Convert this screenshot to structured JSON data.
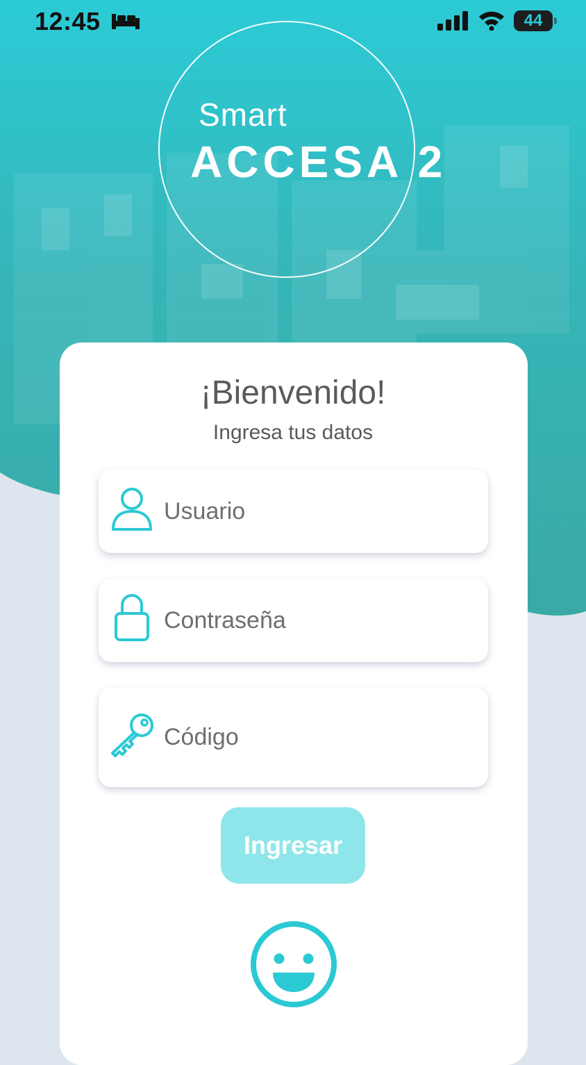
{
  "status_bar": {
    "time": "12:45",
    "battery": "44",
    "icons": [
      "bed-icon",
      "signal-icon",
      "wifi-icon",
      "battery-icon"
    ]
  },
  "logo": {
    "line1": "Smart",
    "line2": "ACCESA 2"
  },
  "login": {
    "title": "¡Bienvenido!",
    "subtitle": "Ingresa tus datos",
    "username_placeholder": "Usuario",
    "password_placeholder": "Contraseña",
    "code_placeholder": "Código",
    "submit_label": "Ingresar",
    "icons": [
      "user-icon",
      "lock-icon",
      "key-icon",
      "face-id-icon"
    ]
  },
  "colors": {
    "accent": "#2bc9d4",
    "hero": "#2fc3cb",
    "button_disabled": "#8fe6ea",
    "page_background": "#dde6ee"
  }
}
